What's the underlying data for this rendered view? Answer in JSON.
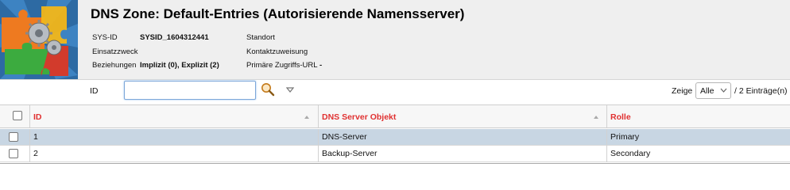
{
  "header": {
    "title": "DNS Zone: Default-Entries (Autorisierende Namensserver)",
    "meta_left": [
      {
        "label": "SYS-ID",
        "value": "SYSID_1604312441"
      },
      {
        "label": "Einsatzzweck",
        "value": ""
      },
      {
        "label": "Beziehungen",
        "value": "Implizit (0), Explizit (2)"
      }
    ],
    "meta_right": [
      {
        "label": "Standort",
        "value": ""
      },
      {
        "label": "Kontaktzuweisung",
        "value": ""
      },
      {
        "label": "Primäre Zugriffs-URL",
        "value": "-"
      }
    ]
  },
  "filter": {
    "label": "ID",
    "value": "",
    "show_label": "Zeige",
    "show_value": "Alle",
    "count": "/ 2 Einträge(n)"
  },
  "table": {
    "columns": [
      "ID",
      "DNS Server Objekt",
      "Rolle"
    ],
    "rows": [
      {
        "id": "1",
        "object": "DNS-Server",
        "role": "Primary",
        "selected": true
      },
      {
        "id": "2",
        "object": "Backup-Server",
        "role": "Secondary",
        "selected": false
      }
    ]
  },
  "colors": {
    "header_bg": "#efefef",
    "column_header_text": "#e03030",
    "selected_row": "#c8d6e3",
    "input_focus": "#7da7d9"
  },
  "icons": {
    "logo": "puzzle-gears-logo-icon",
    "search": "magnifier-search-icon",
    "filter_dropdown": "triangle-down-icon",
    "sort": "sort-arrow-icon"
  }
}
